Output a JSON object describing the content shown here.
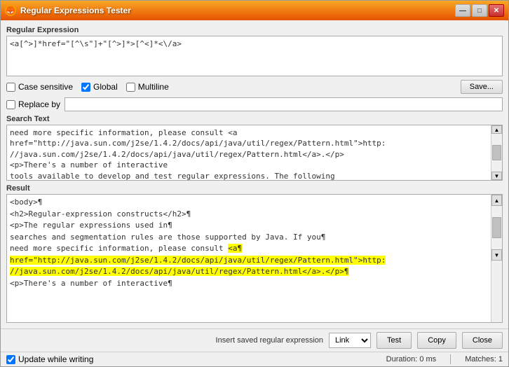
{
  "window": {
    "title": "Regular Expressions Tester",
    "icon": "🦊"
  },
  "title_controls": {
    "minimize": "—",
    "maximize": "□",
    "close": "✕"
  },
  "sections": {
    "regex_label": "Regular Expression",
    "regex_value": "<a[^>]*href=\"[^\\s\"]+\"[^>]*>[^<]*<\\/a>",
    "options": {
      "case_sensitive": "Case sensitive",
      "global": "Global",
      "multiline": "Multiline",
      "global_checked": true,
      "case_checked": false,
      "multiline_checked": false
    },
    "save_label": "Save...",
    "replace_label": "Replace by",
    "search_text_label": "Search Text",
    "search_text_content": "need more specific information, please consult <a\nhref=\"http://java.sun.com/j2se/1.4.2/docs/api/java/util/regex/Pattern.html\">http:\n//java.sun.com/j2se/1.4.2/docs/api/java/util/regex/Pattern.html</a>.</p>\n<p>There's a number of interactive\ntools available to develop and test regular expressions. The following",
    "result_label": "Result",
    "result_lines": [
      "<body>¶",
      "<h2>Regular-expression constructs</h2>¶",
      "<p>The regular expressions used in¶",
      "searches and segmentation rules are those supported by Java. If you¶",
      "need more specific information, please consult <a¶",
      "href=\"http://java.sun.com/j2se/1.4.2/docs/api/java/util/regex/Pattern.html\">http:",
      "//java.sun.com/j2se/1.4.2/docs/api/java/util/regex/Pattern.html</a>.</p>¶",
      "<p>There's a number of interactive¶"
    ],
    "highlighted_start": 4,
    "highlighted_end": 6
  },
  "bottom": {
    "insert_label": "Insert saved regular expression",
    "insert_value": "Link",
    "insert_options": [
      "Link"
    ],
    "test_label": "Test",
    "copy_label": "Copy",
    "close_label": "Close"
  },
  "status": {
    "update_label": "Update while writing",
    "duration_label": "Duration: 0 ms",
    "matches_label": "Matches: 1"
  }
}
